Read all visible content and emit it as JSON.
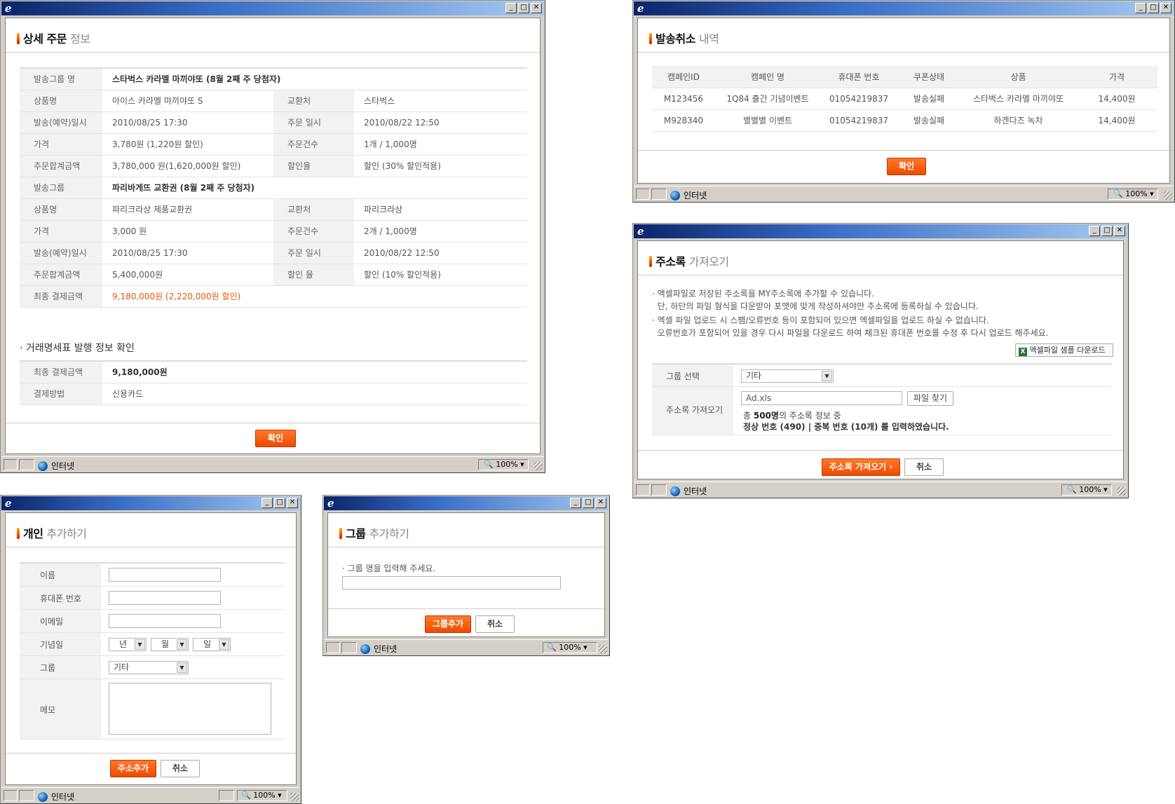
{
  "statusbar": {
    "zone": "인터넷",
    "zoom": "100%"
  },
  "order": {
    "title": "상세 주문",
    "title_sub": "정보",
    "rows": [
      [
        "발송그룹 명",
        "스타벅스 카라멜 마끼야또 (8월 2째 주 당첨자)"
      ],
      [
        "상품명",
        "아이스 카라멜 마끼야또 S",
        "교환처",
        "스타벅스"
      ],
      [
        "발송(예약)일시",
        "2010/08/25  17:30",
        "주문 일시",
        "2010/08/22 12:50"
      ],
      [
        "가격",
        "3,780원 (1,220원 할인)",
        "주문건수",
        "1개 / 1,000명"
      ],
      [
        "주문합계금액",
        "3,780,000 원(1,620,000원 할인)",
        "할인율",
        "할인 (30% 할인적용)"
      ],
      [
        "발송그룹",
        "파리바게뜨 교환권 (8월 2째 주 당첨자)"
      ],
      [
        "상품명",
        "파리크라상 제품교환권",
        "교환처",
        "파리크라상"
      ],
      [
        "가격",
        "3,000 원",
        "주문건수",
        "2개 / 1,000명"
      ],
      [
        "발송(예약)일시",
        "2010/08/25  17:30",
        "주문 일시",
        "2010/08/22 12:50"
      ],
      [
        "주문합계금액",
        "5,400,000원",
        "할인 율",
        "할인 (10% 할인적용)"
      ],
      [
        "최종 결제금액",
        "9,180,000원 (2,220,000원 할인)"
      ]
    ],
    "section": "· 거래명세표 발행 정보 확인",
    "pay_rows": [
      [
        "최종 결제금액",
        "9,180,000원"
      ],
      [
        "결제방법",
        "신용카드"
      ]
    ],
    "confirm": "확인"
  },
  "cancel": {
    "title": "발송취소",
    "title_sub": "내역",
    "headers": [
      "캠페인ID",
      "캠페인 명",
      "휴대폰 번호",
      "쿠폰상태",
      "상품",
      "가격"
    ],
    "rows": [
      [
        "M123456",
        "1Q84 출간 기념이벤트",
        "01054219837",
        "발송실패",
        "스타벅스 카라멜 마끼야또",
        "14,400원"
      ],
      [
        "M928340",
        "별별별 이벤트",
        "01054219837",
        "발송실패",
        "하겐다즈 녹차",
        "14,400원"
      ]
    ],
    "confirm": "확인"
  },
  "address": {
    "title": "주소록",
    "title_sub": "가져오기",
    "notes": [
      "· 엑셀파일로 저장된 주소록을 MY주소록에 추가할 수 있습니다.",
      "  단, 하단의 파일 형식을 다운받아 포맷에 맞게 작성하셔야만 주소록에 등록하실 수 있습니다.",
      "· 엑셀 파일 업로드 시 스팸/오류번호 등이 포함되어 있으면 엑셀파일을 업로드 하실 수 없습니다.",
      "  오류번호가 포함되어 있을 경우 다시 파일을 다운로드 하여 체크된 휴대폰 번호를 수정 후 다시 업로드 해주세요."
    ],
    "sample_btn": "엑셀파일 샘플 다운로드",
    "group_label": "그룹 선택",
    "group_value": "기타",
    "import_label": "주소록 가져오기",
    "file_value": "Ad.xls",
    "file_btn": "파일 찾기",
    "info1_pre": "총 ",
    "info1_bold": "500명",
    "info1_post": "의 주소록 정보 중",
    "info2": "정상 번호 (490) | 중복 번호 (10개) 를 입력하였습니다.",
    "submit": "주소록 가져오기 ›",
    "cancel": "취소"
  },
  "person": {
    "title": "개인",
    "title_sub": "추가하기",
    "name_label": "이름",
    "phone_label": "휴대폰 번호",
    "email_label": "이메일",
    "anniv_label": "기념일",
    "year": "년",
    "month": "월",
    "day": "일",
    "group_label": "그룹",
    "group_value": "기타",
    "memo_label": "메모",
    "submit": "주소추가",
    "cancel": "취소"
  },
  "group": {
    "title": "그룹",
    "title_sub": "추가하기",
    "prompt": "· 그룹 명을 입력해 주세요.",
    "submit": "그룹추가",
    "cancel": "취소"
  }
}
